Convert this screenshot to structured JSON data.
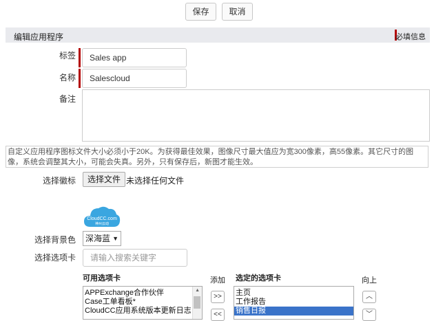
{
  "toolbar": {
    "save_label": "保存",
    "cancel_label": "取消"
  },
  "section": {
    "title": "编辑应用程序",
    "required_legend": "必填信息"
  },
  "fields": {
    "tag_label": "标签",
    "tag_value": "Sales app",
    "name_label": "名称",
    "name_value": "Salescloud",
    "note_label": "备注"
  },
  "hint": "自定义应用程序图标文件大小必须小于20K。为获得最佳效果，图像尺寸最大值应为宽300像素，高55像素。其它尺寸的图像，系统会调整其大小，可能会失真。另外，只有保存后，新图才能生效。",
  "icon_picker": {
    "label": "选择徽标",
    "button": "选择文件",
    "status": "未选择任何文件"
  },
  "logo": {
    "text": "CloudCC.com",
    "subtext": "神州云动",
    "color": "#3aa6e0"
  },
  "background_color": {
    "label": "选择背景色",
    "selected": "深海蓝"
  },
  "tab_select": {
    "label": "选择选项卡",
    "search_placeholder": "请输入搜索关键字"
  },
  "available_tabs": {
    "header": "可用选项卡",
    "items": [
      "APPExchange合作伙伴",
      "Case工单看板*",
      "CloudCC应用系统版本更新日志"
    ]
  },
  "transfer": {
    "add_label": "添加",
    "add_icon": "double-chevron-right",
    "remove_icon": "double-chevron-left"
  },
  "selected_tabs": {
    "header": "选定的选项卡",
    "items": [
      "主页",
      "工作报告",
      "销售日报"
    ],
    "selected_item": "销售日报"
  },
  "order": {
    "up_label": "向上"
  },
  "colors": {
    "required": "#b30000",
    "selection": "#3a73c9"
  }
}
